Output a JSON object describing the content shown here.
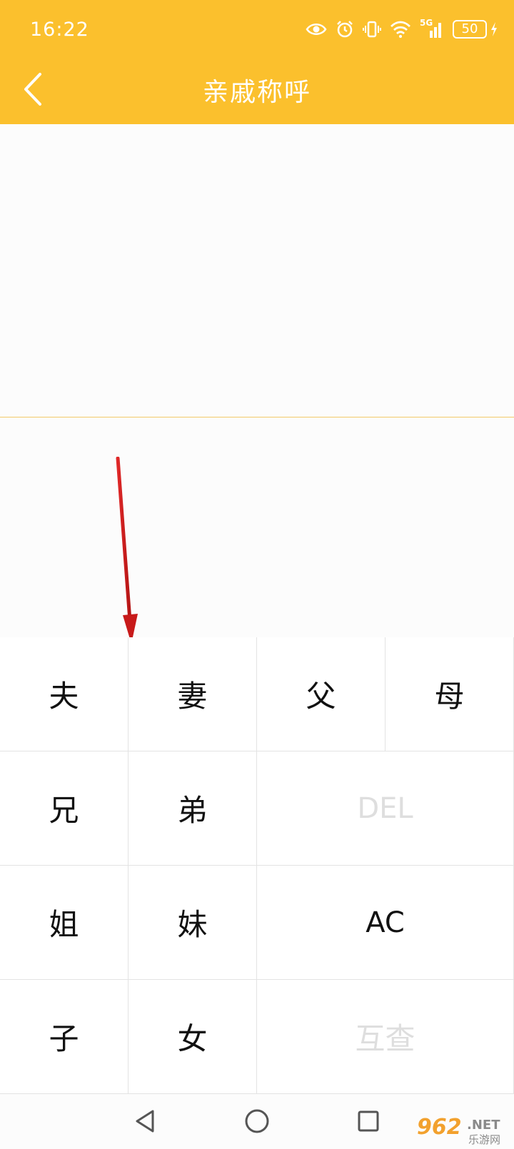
{
  "status_bar": {
    "time": "16:22",
    "battery": "50",
    "network": "5G",
    "icons": [
      "eye-icon",
      "alarm-icon",
      "vibrate-icon",
      "wifi-icon",
      "signal-icon",
      "battery-icon",
      "charging-icon"
    ]
  },
  "header": {
    "title": "亲戚称呼",
    "back_icon": "chevron-left-icon",
    "background_color": "#fbc02d"
  },
  "keypad": {
    "keys": {
      "husband": "夫",
      "wife": "妻",
      "father": "父",
      "mother": "母",
      "elder_brother": "兄",
      "younger_brother": "弟",
      "delete": "DEL",
      "elder_sister": "姐",
      "younger_sister": "妹",
      "clear": "AC",
      "son": "子",
      "daughter": "女",
      "mutual_lookup": "互查"
    },
    "disabled_color": "#dedede"
  },
  "navbar": {
    "icons": [
      "back-triangle-icon",
      "home-circle-icon",
      "recents-square-icon"
    ]
  },
  "watermark": {
    "brand": "962",
    "suffix": ".NET",
    "tagline": "乐游网"
  },
  "annotation": {
    "color": "#d42020"
  }
}
